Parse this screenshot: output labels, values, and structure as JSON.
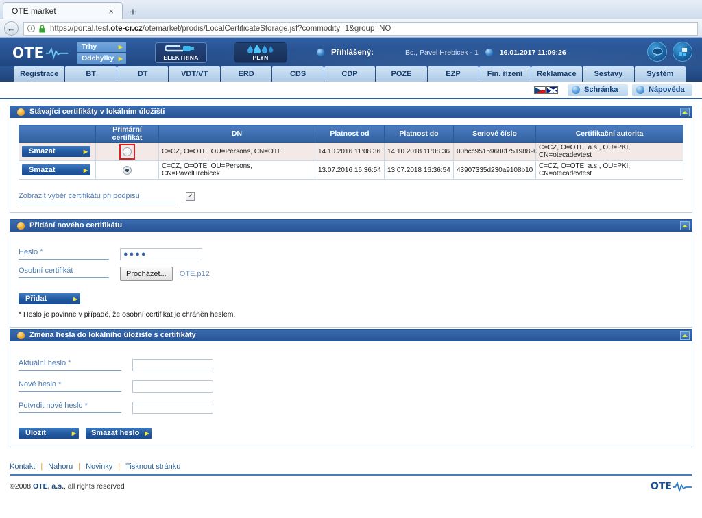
{
  "browser": {
    "tab_title": "OTE market",
    "tab_close": "×",
    "new_tab": "+",
    "back_glyph": "←",
    "url_prefix": "https://portal.test.",
    "url_bold": "ote-cr.cz",
    "url_suffix": "/otemarket/prodis/LocalCertificateStorage.jsf?commodity=1&group=NO"
  },
  "header": {
    "logo": "OTE",
    "menu": [
      {
        "label": "Trhy",
        "arrow": "▶"
      },
      {
        "label": "Odchylky",
        "arrow": "▶"
      }
    ],
    "commodities": [
      {
        "label": "ELEKTRINA"
      },
      {
        "label": "PLYN"
      }
    ],
    "logged_label": "Přihlášený:",
    "user": "Bc., Pavel Hrebicek - 1",
    "datetime": "16.01.2017 11:09:26",
    "icons": [
      {
        "name": "chat-icon",
        "glyph": "💬"
      },
      {
        "name": "windows-icon",
        "glyph": "❐"
      }
    ],
    "nav": [
      "Registrace",
      "BT",
      "DT",
      "VDT/VT",
      "ERD",
      "CDS",
      "CDP",
      "POZE",
      "EZP",
      "Fin. řízení",
      "Reklamace",
      "Sestavy",
      "Systém"
    ],
    "subbar": {
      "clipboard": "Schránka",
      "help": "Nápověda"
    }
  },
  "panels": {
    "existing": {
      "title": "Stávající certifikáty v lokálním úložišti",
      "columns": [
        "",
        "Primární certifikát",
        "DN",
        "Platnost od",
        "Platnost do",
        "Seriové číslo",
        "Certifikační autorita"
      ],
      "rows": [
        {
          "action": "Smazat",
          "primary_selected": false,
          "highlighted": true,
          "dn": "C=CZ, O=OTE, OU=Persons, CN=OTE",
          "valid_from": "14.10.2016 11:08:36",
          "valid_to": "14.10.2018 11:08:36",
          "serial": "00bcc95159680f75198890",
          "ca": "C=CZ, O=OTE, a.s., OU=PKI, CN=otecadevtest"
        },
        {
          "action": "Smazat",
          "primary_selected": true,
          "highlighted": false,
          "dn": "C=CZ, O=OTE, OU=Persons, CN=PavelHrebicek",
          "valid_from": "13.07.2016 16:36:54",
          "valid_to": "13.07.2018 16:36:54",
          "serial": "43907335d230a9108b10",
          "ca": "C=CZ, O=OTE, a.s., OU=PKI, CN=otecadevtest"
        }
      ],
      "show_picker_label": "Zobrazit výběr certifikátu při podpisu",
      "show_picker_checked": true,
      "check_glyph": "✓"
    },
    "add": {
      "title": "Přidání nového certifikátu",
      "password_label": "Heslo",
      "password_req": "*",
      "password_value": "●●●●",
      "cert_label": "Osobní certifikát",
      "browse_button": "Procházet...",
      "file_name": "OTE.p12",
      "add_button": "Přidat",
      "note": "* Heslo je povinné v případě, že osobní certifikát je chráněn heslem."
    },
    "change": {
      "title": "Změna hesla do lokálního úložište s certifikáty",
      "fields": [
        {
          "label": "Aktuální heslo",
          "req": "*",
          "value": ""
        },
        {
          "label": "Nové heslo",
          "req": "*",
          "value": ""
        },
        {
          "label": "Potvrdit nové heslo",
          "req": "*",
          "value": ""
        }
      ],
      "save_button": "Uložit",
      "delete_button": "Smazat heslo"
    }
  },
  "footer": {
    "links": [
      "Kontakt",
      "Nahoru",
      "Novinky",
      "Tisknout stránku"
    ],
    "separator": "|",
    "copyright_prefix": "©2008 ",
    "copyright_brand": "OTE, a.s.",
    "copyright_suffix": ", all rights reserved",
    "logo": "OTE"
  }
}
